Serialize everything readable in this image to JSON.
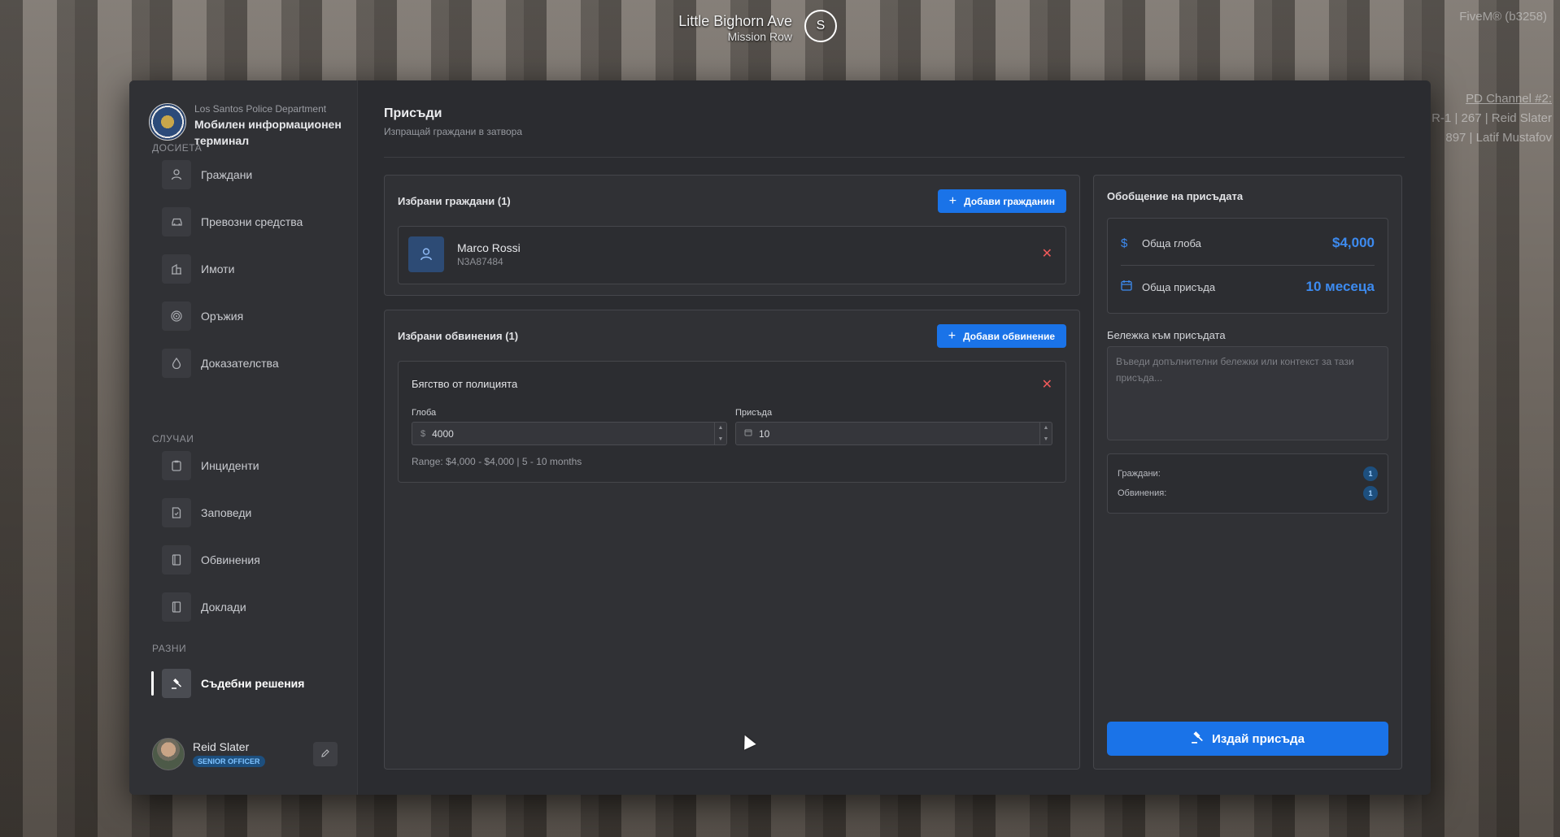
{
  "hud": {
    "street": "Little Bighorn Ave",
    "area": "Mission Row",
    "compass": "S",
    "server": "FiveM® (b3258)",
    "channel_title": "PD Channel #2:",
    "channel_line1": "R-1 | 267 | Reid Slater",
    "channel_line2": "897 | Latif Mustafov"
  },
  "sidebar": {
    "org": "Los Santos Police Department",
    "title": "Мобилен информационен терминал",
    "sections": [
      {
        "label": "ДОСИЕТА"
      },
      {
        "label": "СЛУЧАИ"
      },
      {
        "label": "РАЗНИ"
      }
    ],
    "items": [
      {
        "label": "Граждани",
        "icon": "user-icon"
      },
      {
        "label": "Превозни средства",
        "icon": "car-icon"
      },
      {
        "label": "Имоти",
        "icon": "building-icon"
      },
      {
        "label": "Оръжия",
        "icon": "target-icon"
      },
      {
        "label": "Доказателства",
        "icon": "drop-icon"
      },
      {
        "label": "Инциденти",
        "icon": "clipboard-icon"
      },
      {
        "label": "Заповеди",
        "icon": "file-icon"
      },
      {
        "label": "Обвинения",
        "icon": "book-icon"
      },
      {
        "label": "Доклади",
        "icon": "book-icon"
      },
      {
        "label": "Съдебни решения",
        "icon": "gavel-icon"
      }
    ],
    "user": {
      "name": "Reid Slater",
      "rank": "SENIOR OFFICER"
    }
  },
  "page": {
    "title": "Присъди",
    "subtitle": "Изпращай граждани в затвора"
  },
  "citizens": {
    "title": "Избрани граждани (1)",
    "add_label": "Добави гражданин",
    "list": [
      {
        "name": "Marco Rossi",
        "id": "N3A87484"
      }
    ]
  },
  "charges": {
    "title": "Избрани обвинения (1)",
    "add_label": "Добави обвинение",
    "list": [
      {
        "name": "Бягство от полицията",
        "fine_label": "Глоба",
        "fine_prefix": "$",
        "fine_value": "4000",
        "sentence_label": "Присъда",
        "sentence_value": "10",
        "range": "Range: $4,000 - $4,000 | 5 - 10 months"
      }
    ]
  },
  "summary": {
    "title": "Обобщение на присъдата",
    "fine_label": "Обща глоба",
    "fine_value": "$4,000",
    "sentence_label": "Обща присъда",
    "sentence_value": "10 месеца",
    "note_label": "Бележка към присъдата",
    "note_placeholder": "Въведи допълнителни бележки или контекст за тази присъда...",
    "citizens_label": "Граждани:",
    "citizens_count": "1",
    "charges_label": "Обвинения:",
    "charges_count": "1",
    "issue_label": "Издай присъда"
  },
  "colors": {
    "accent": "#1a73e8",
    "danger": "#ef5a5a",
    "panel": "#303135",
    "background": "#2b2c30"
  }
}
